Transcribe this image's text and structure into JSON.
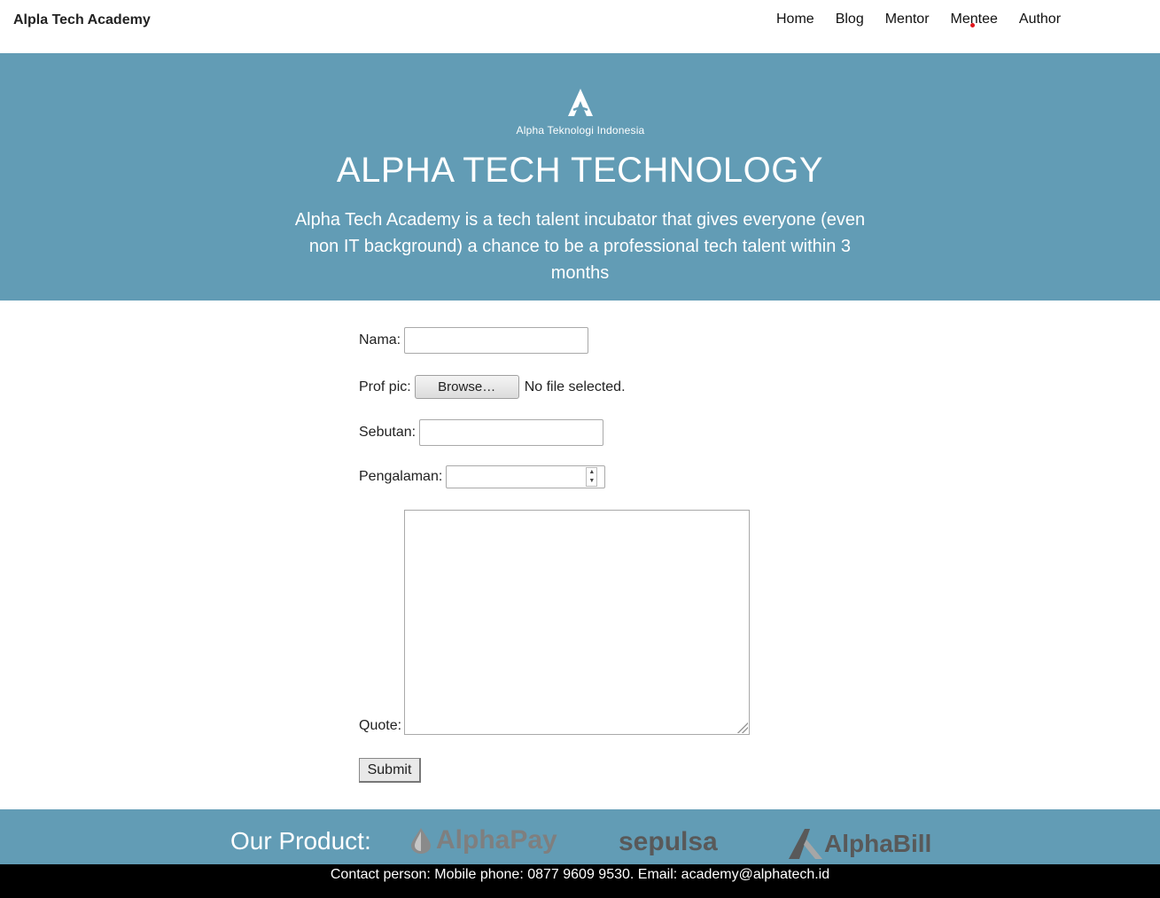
{
  "header": {
    "brand": "Alpla Tech Academy",
    "nav": [
      "Home",
      "Blog",
      "Mentor",
      "Mentee",
      "Author"
    ]
  },
  "hero": {
    "logo_text": "Alpha Teknologi Indonesia",
    "title": "ALPHA TECH TECHNOLOGY",
    "tagline": "Alpha Tech Academy is a tech talent incubator that gives everyone (even non IT background) a chance to be a professional tech talent within 3 months"
  },
  "form": {
    "nama_label": "Nama:",
    "nama_value": "",
    "profpic_label": "Prof pic:",
    "browse_label": "Browse…",
    "no_file": "No file selected.",
    "sebutan_label": "Sebutan:",
    "sebutan_value": "",
    "pengalaman_label": "Pengalaman:",
    "pengalaman_value": "",
    "quote_label": "Quote:",
    "quote_value": "",
    "submit_label": "Submit"
  },
  "products": {
    "label": "Our Product:",
    "items": [
      "AlphaPay",
      "sepulsa",
      "AlphaBill"
    ]
  },
  "footer": {
    "contact": "Contact person: Mobile phone: 0877 9609 9530. Email: academy@alphatech.id"
  },
  "colors": {
    "hero_bg": "#629cb5",
    "footer_bg": "#000000",
    "nav_dot": "#e0161c"
  }
}
